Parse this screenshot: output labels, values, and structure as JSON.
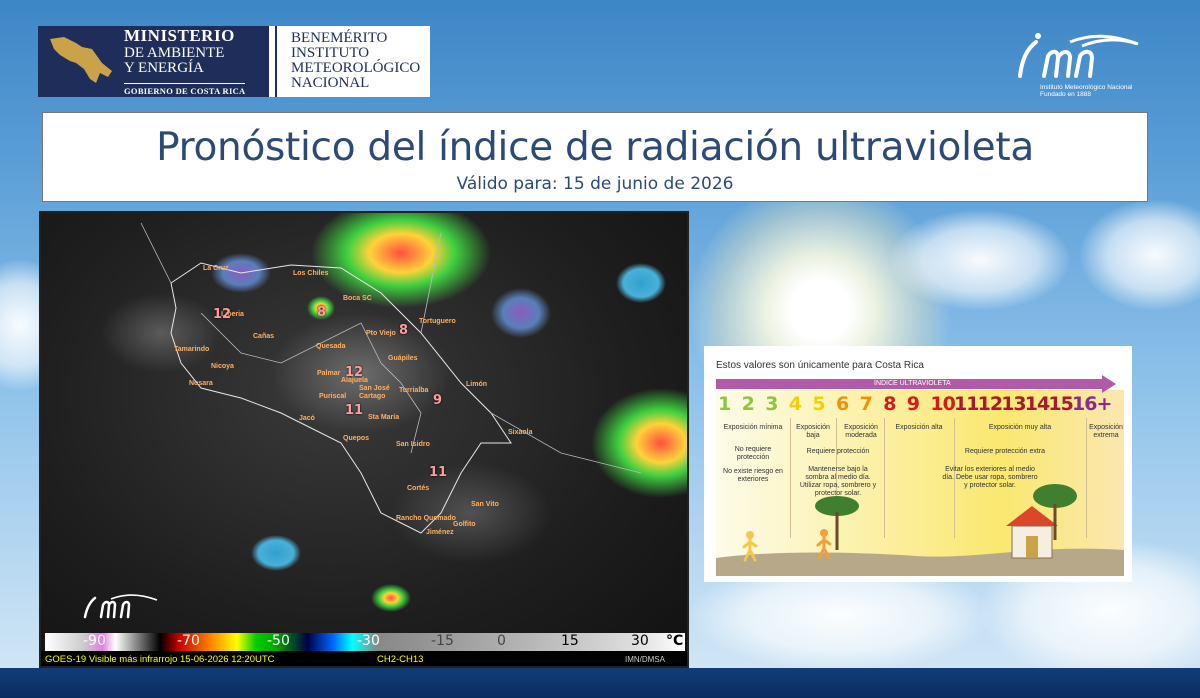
{
  "ministerio_logo": {
    "line1": "MINISTERIO",
    "line2": "DE AMBIENTE",
    "line3": "Y ENERGÍA",
    "line4": "GOBIERNO DE COSTA RICA"
  },
  "imn_seal": {
    "line1": "BENEMÉRITO",
    "line2": "INSTITUTO",
    "line3": "METEOROLÓGICO",
    "line4": "NACIONAL"
  },
  "imn_logo": {
    "sub1": "Instituto Meteorológico Nacional",
    "sub2": "Fundado en 1888"
  },
  "title": {
    "main": "Pronóstico del índice de radiación ultravioleta",
    "valid": "Válido para: 15 de junio de 2026"
  },
  "satellite": {
    "caption_left": "GOES-19 Visible más infrarrojo 15-06-2026 12:20UTC",
    "caption_mid": "CH2-CH13",
    "caption_right": "IMN/DMSA",
    "colorbar_labels": [
      "-90",
      "-70",
      "-50",
      "-30",
      "-15",
      "0",
      "15",
      "30",
      "°C"
    ],
    "cities": [
      "La Cruz",
      "Los Chiles",
      "Liberia",
      "Cañas",
      "Boca SC",
      "Pto Viejo",
      "Tortuguero",
      "Quesada",
      "Tamarindo",
      "Nicoya",
      "Palmar",
      "Alajuela",
      "San José",
      "Guápiles",
      "Limón",
      "Nosara",
      "Puriscal",
      "Cartago",
      "Turrialba",
      "Jacó",
      "Sta María",
      "Quepos",
      "San Isidro",
      "Sixaola",
      "Cortés",
      "San Vito",
      "Rancho Quemado",
      "Golfito",
      "Jiménez"
    ],
    "uv_values": [
      "12",
      "8",
      "8",
      "12",
      "11",
      "9",
      "11"
    ]
  },
  "uv_table": {
    "header": "Estos valores son únicamente para Costa Rica",
    "arrow_label": "ÍNDICE ULTRAVIOLETA",
    "numbers": [
      "1",
      "2",
      "3",
      "4",
      "5",
      "6",
      "7",
      "8",
      "9",
      "10",
      "11",
      "12",
      "13",
      "14",
      "15",
      "16+"
    ],
    "number_colors": [
      "#8cc63f",
      "#8cc63f",
      "#8cc63f",
      "#f5d000",
      "#f5d000",
      "#f39200",
      "#f39200",
      "#d7191c",
      "#d7191c",
      "#d7191c",
      "#a6192e",
      "#a6192e",
      "#a6192e",
      "#a6192e",
      "#a6192e",
      "#8b2a8b"
    ],
    "exposure": [
      "Exposición mínima",
      "Exposición baja",
      "Exposición moderada",
      "Exposición alta",
      "Exposición muy alta",
      "Exposición extrema"
    ],
    "protection": [
      "No requiere protección",
      "Requiere protección",
      "Requiere protección extra"
    ],
    "advice": [
      "No existe riesgo en exteriores",
      "Mantenerse bajo la sombra al medio día. Utilizar ropa, sombrero y protector solar.",
      "Evitar los exteriores al medio día. Debe usar ropa, sombrero y protector solar."
    ]
  }
}
